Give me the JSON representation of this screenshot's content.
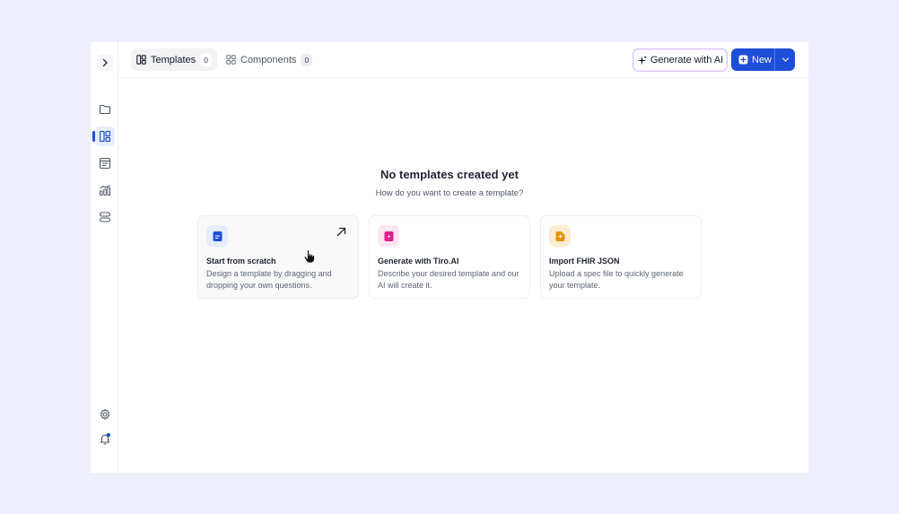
{
  "header": {
    "tabs": [
      {
        "label": "Templates",
        "count": "0",
        "icon": "layout-icon",
        "active": true
      },
      {
        "label": "Components",
        "count": "0",
        "icon": "grid-icon",
        "active": false
      }
    ],
    "generate_ai_label": "Generate with AI",
    "new_label": "New"
  },
  "sidebar": {
    "items": [
      {
        "icon": "folder-icon"
      },
      {
        "icon": "templates-icon",
        "active": true
      },
      {
        "icon": "form-icon"
      },
      {
        "icon": "analytics-icon"
      },
      {
        "icon": "stack-icon"
      }
    ],
    "bottom": [
      {
        "icon": "settings-icon"
      },
      {
        "icon": "bell-icon",
        "has_badge": true
      }
    ]
  },
  "empty_state": {
    "title": "No templates created yet",
    "subtitle": "How do you want to create a template?"
  },
  "cards": [
    {
      "title": "Start from scratch",
      "desc": "Design a template by dragging and dropping your own questions.",
      "icon": "document-icon",
      "accent": "#1d4ed8"
    },
    {
      "title": "Generate with Tiro.AI",
      "desc": "Describe your desired template and our AI will create it.",
      "icon": "ai-document-icon",
      "accent": "#e11d8f"
    },
    {
      "title": "Import FHIR JSON",
      "desc": "Upload a spec file to quickly generate your template.",
      "icon": "import-file-icon",
      "accent": "#e8940a"
    }
  ],
  "colors": {
    "primary": "#1d4ed8",
    "background": "#eeeffc"
  }
}
